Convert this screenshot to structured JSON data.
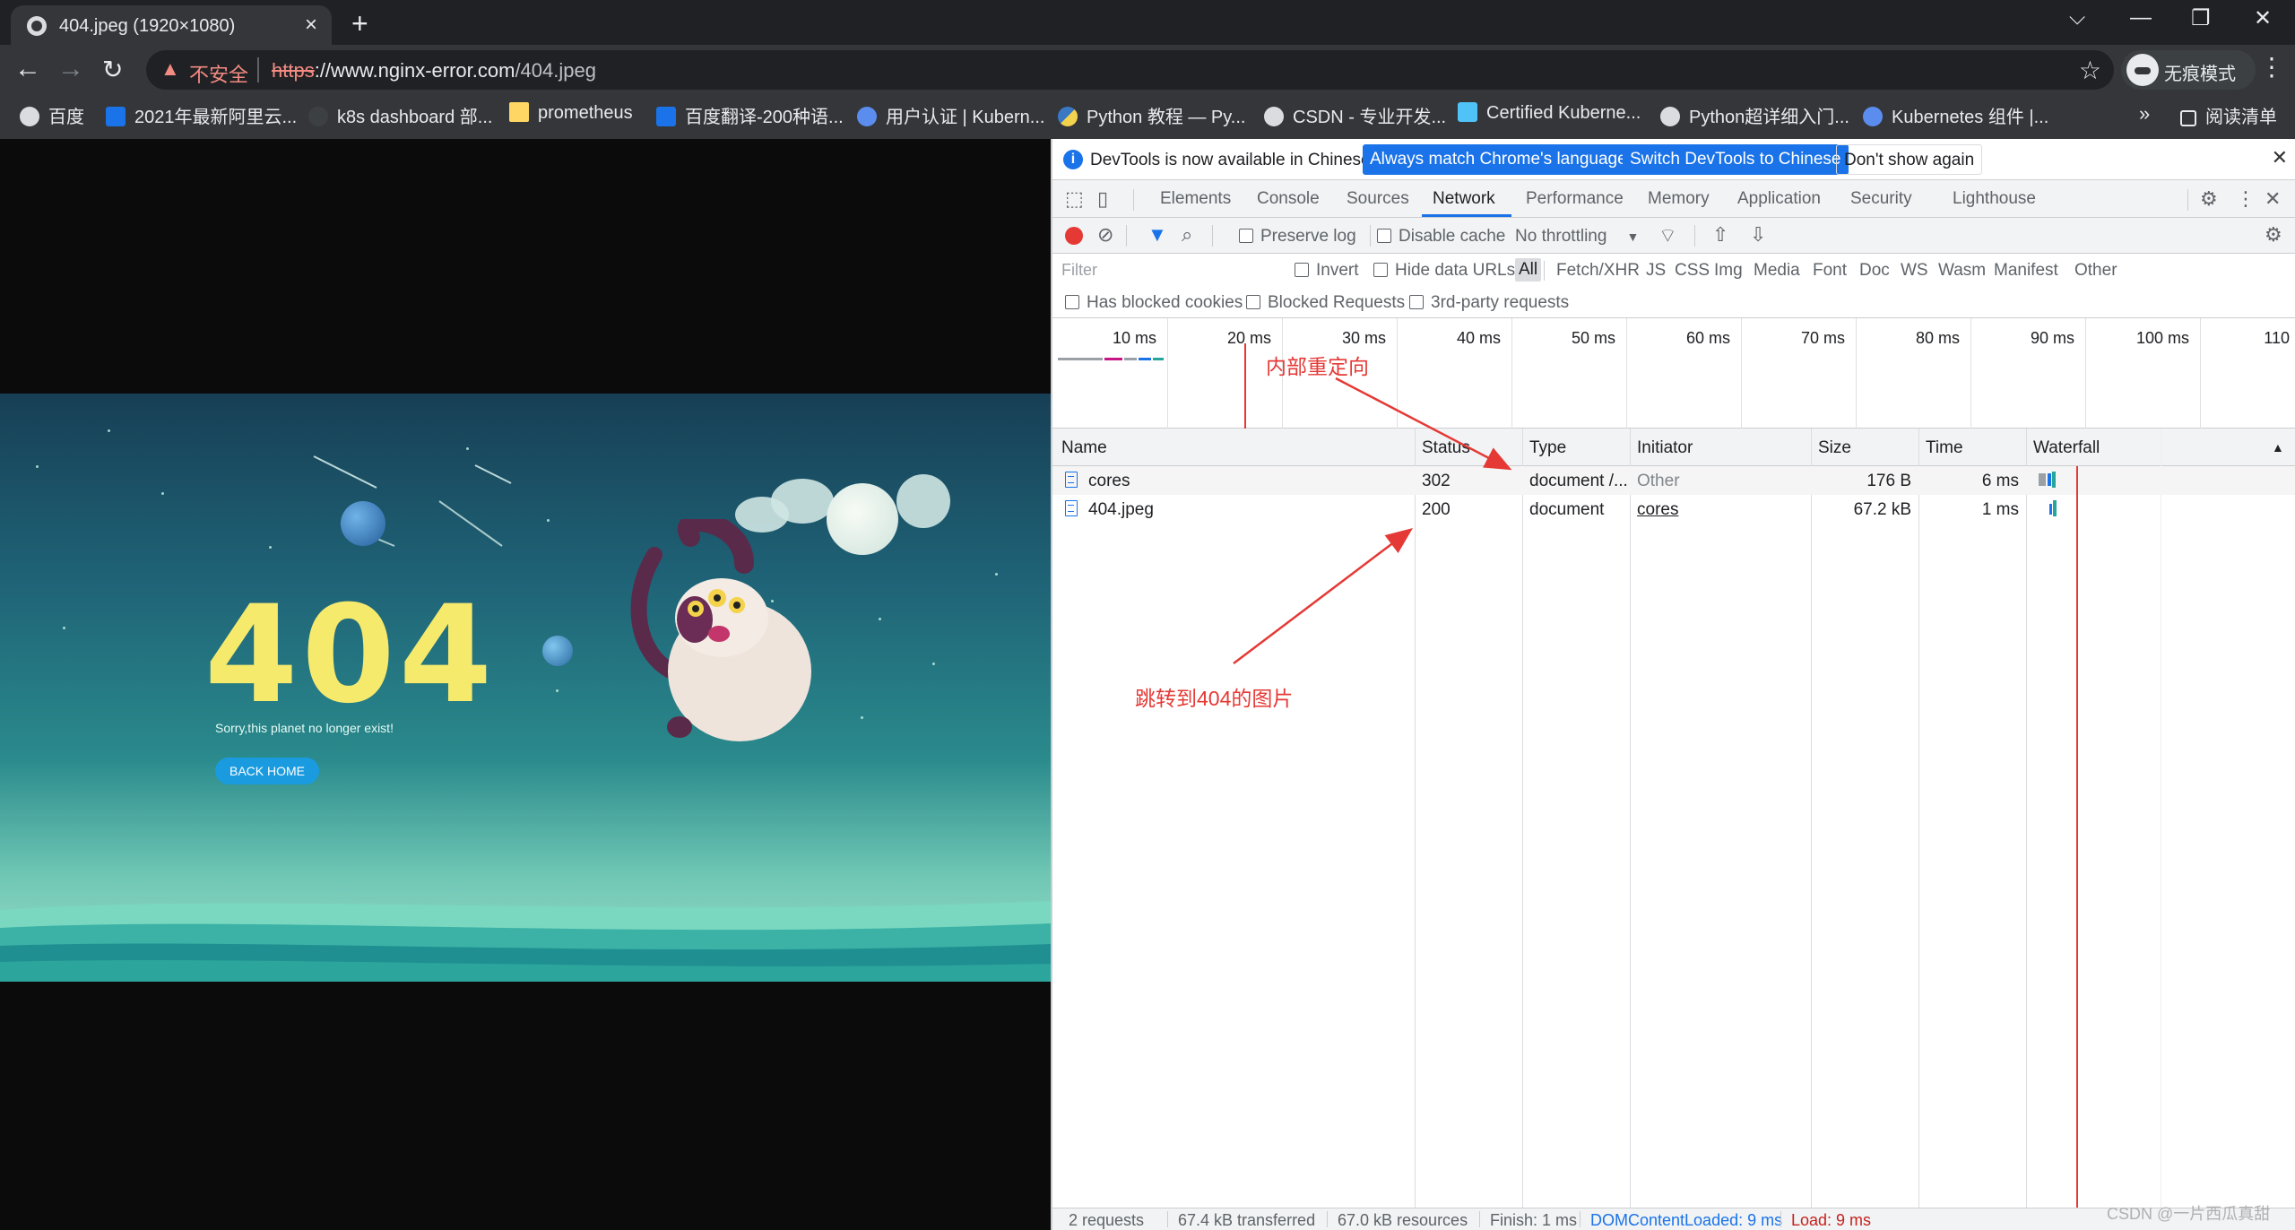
{
  "tab": {
    "title": "404.jpeg (1920×1080)"
  },
  "window_controls": [
    "⌵",
    "—",
    "❐",
    "✕"
  ],
  "address": {
    "warning": "不安全",
    "url_scheme": "https",
    "url_host": "://www.nginx-error.com",
    "url_path": "/404.jpeg"
  },
  "incognito_label": "无痕模式",
  "bookmarks": [
    {
      "label": "百度",
      "icon": "globe-icon"
    },
    {
      "label": "2021年最新阿里云...",
      "icon": "blue-square-icon"
    },
    {
      "label": "k8s dashboard 部...",
      "icon": "dark-icon"
    },
    {
      "label": "prometheus",
      "icon": "folder-icon"
    },
    {
      "label": "百度翻译-200种语...",
      "icon": "translate-icon"
    },
    {
      "label": "用户认证 | Kubern...",
      "icon": "k8s-icon"
    },
    {
      "label": "Python 教程 — Py...",
      "icon": "python-icon"
    },
    {
      "label": "CSDN - 专业开发...",
      "icon": "globe-icon"
    },
    {
      "label": "Certified Kuberne...",
      "icon": "cyan-icon"
    },
    {
      "label": "Python超详细入门...",
      "icon": "globe-icon"
    },
    {
      "label": "Kubernetes 组件 |...",
      "icon": "k8s-icon"
    }
  ],
  "bookmarks_more": "»",
  "reading_list": "阅读清单",
  "page_image": {
    "big_text": "404",
    "sorry": "Sorry,this planet no longer exist!",
    "button": "BACK HOME"
  },
  "devtools": {
    "info_message": "DevTools is now available in Chinese!",
    "btn_match": "Always match Chrome's language",
    "btn_switch": "Switch DevTools to Chinese",
    "btn_dismiss": "Don't show again",
    "tabs": [
      "Elements",
      "Console",
      "Sources",
      "Network",
      "Performance",
      "Memory",
      "Application",
      "Security",
      "Lighthouse"
    ],
    "active_tab": "Network",
    "toolbar": {
      "preserve_log": "Preserve log",
      "disable_cache": "Disable cache",
      "throttling": "No throttling"
    },
    "filter": {
      "placeholder": "Filter",
      "invert": "Invert",
      "hide_data_urls": "Hide data URLs",
      "types": [
        "All",
        "Fetch/XHR",
        "JS",
        "CSS",
        "Img",
        "Media",
        "Font",
        "Doc",
        "WS",
        "Wasm",
        "Manifest",
        "Other"
      ]
    },
    "blocked": {
      "has_blocked_cookies": "Has blocked cookies",
      "blocked_requests": "Blocked Requests",
      "third_party": "3rd-party requests"
    },
    "overview_ticks": [
      "10 ms",
      "20 ms",
      "30 ms",
      "40 ms",
      "50 ms",
      "60 ms",
      "70 ms",
      "80 ms",
      "90 ms",
      "100 ms",
      "110"
    ],
    "columns": [
      "Name",
      "Status",
      "Type",
      "Initiator",
      "Size",
      "Time",
      "Waterfall"
    ],
    "rows": [
      {
        "name": "cores",
        "status": "302",
        "type": "document /...",
        "initiator": "Other",
        "size": "176 B",
        "time": "6 ms"
      },
      {
        "name": "404.jpeg",
        "status": "200",
        "type": "document",
        "initiator": "cores",
        "size": "67.2 kB",
        "time": "1 ms"
      }
    ],
    "status": {
      "requests": "2 requests",
      "transferred": "67.4 kB transferred",
      "resources": "67.0 kB resources",
      "finish": "Finish: 1 ms",
      "dom": "DOMContentLoaded: 9 ms",
      "load": "Load: 9 ms"
    }
  },
  "annotations": {
    "internal_redirect": "内部重定向",
    "jump_to_404": "跳转到404的图片"
  },
  "watermark": "CSDN @一片西瓜真甜",
  "colors": {
    "accent": "#1a73e8",
    "annotation": "#e53935",
    "record": "#e53935"
  }
}
